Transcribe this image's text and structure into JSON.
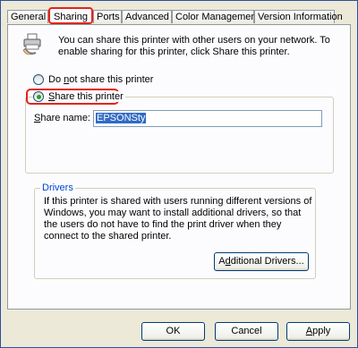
{
  "tabs": [
    {
      "label": "General"
    },
    {
      "label": "Sharing"
    },
    {
      "label": "Ports"
    },
    {
      "label": "Advanced"
    },
    {
      "label": "Color Management"
    },
    {
      "label": "Version Information"
    }
  ],
  "sharing": {
    "intro_text": "You can share this printer with other users on your network. To enable sharing for this printer, click Share this printer.",
    "radio_not_share": {
      "label_pre": "Do ",
      "label_u": "n",
      "label_post": "ot share this printer",
      "checked": false
    },
    "radio_share": {
      "label_pre": "",
      "label_u": "S",
      "label_post": "hare this printer",
      "checked": true
    },
    "share_name_label_u": "S",
    "share_name_label_post": "hare name:",
    "share_name_value": "EPSONSty"
  },
  "drivers": {
    "group_title": "Drivers",
    "text": "If this printer is shared with users running different versions of Windows, you may want to install additional drivers, so that the users do not have to find the print driver when they connect to the shared printer.",
    "additional_pre": "A",
    "additional_u": "d",
    "additional_post": "ditional Drivers..."
  },
  "buttons": {
    "ok": "OK",
    "cancel": "Cancel",
    "apply_u": "A",
    "apply_post": "pply"
  },
  "colors": {
    "highlight_red": "#e4231b",
    "accent_blue": "#0046d5",
    "selection": "#316ac5"
  },
  "icons": {
    "printer": "printer-share-icon"
  }
}
